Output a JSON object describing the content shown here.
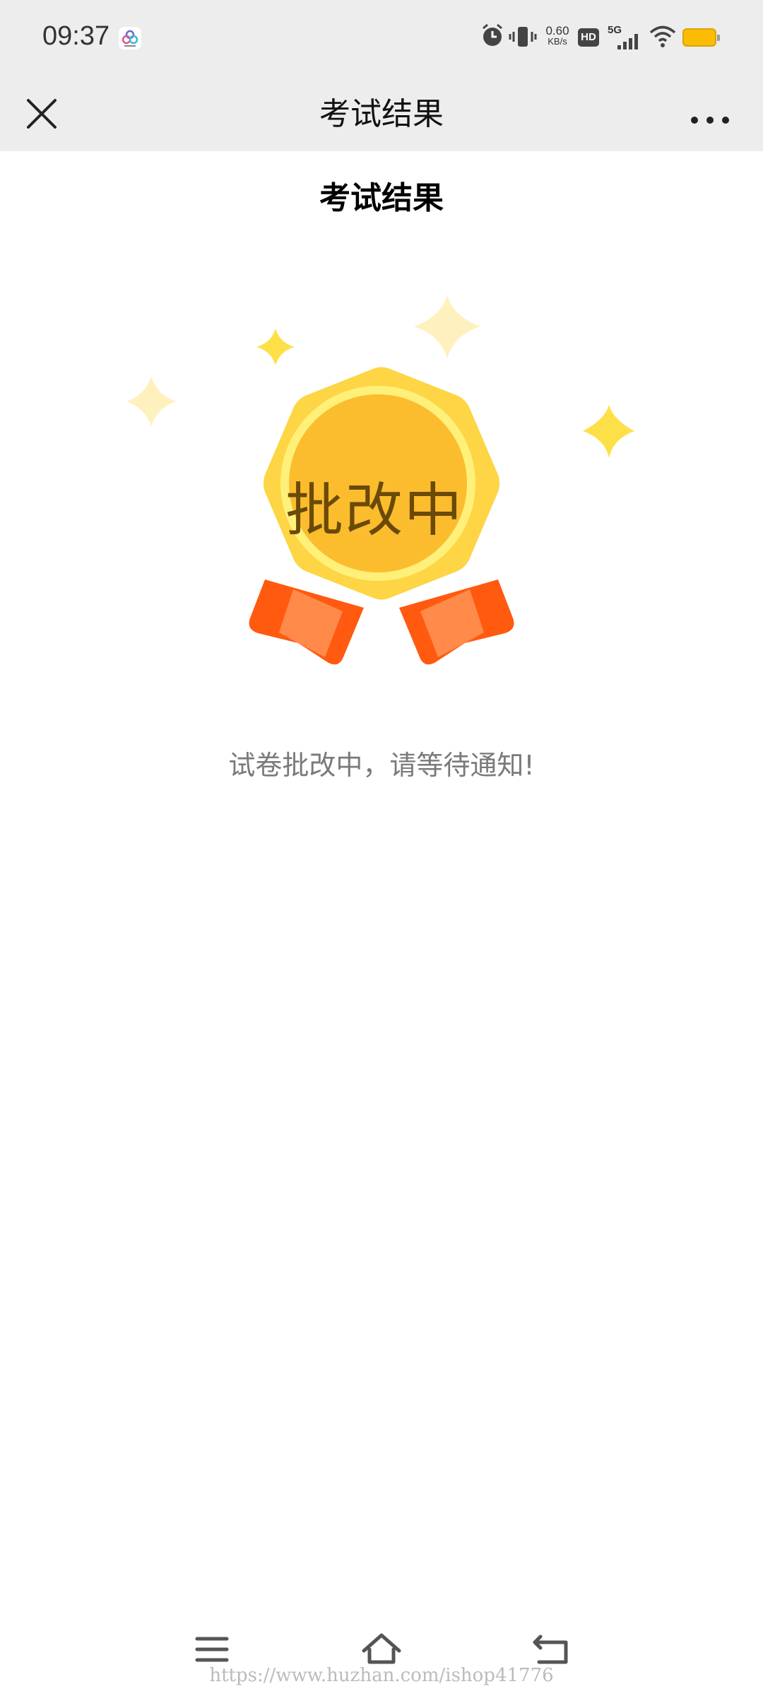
{
  "status_bar": {
    "time": "09:37",
    "net_speed_value": "0.60",
    "net_speed_unit": "KB/s",
    "hd_label": "HD",
    "network_label": "5G",
    "icons": [
      "app-notification-icon",
      "alarm-icon",
      "vibrate-icon",
      "hd-icon",
      "signal-icon",
      "wifi-icon",
      "battery-icon"
    ],
    "battery_color": "#fbbc05"
  },
  "nav_bar": {
    "title": "考试结果",
    "close_icon": "close-icon",
    "more_icon": "more-icon",
    "background": "#ededed"
  },
  "page": {
    "heading": "考试结果",
    "medal_label": "批改中",
    "message": "试卷批改中，请等待通知!",
    "medal_colors": {
      "outer": "#fdd545",
      "ring": "#fff07a",
      "inner": "#fbbd2e",
      "ribbon_dark": "#ff5a0f",
      "ribbon_light": "#ff8a4a",
      "sparkle": "#fde047"
    }
  },
  "system_nav": {
    "icons": [
      "menu-icon",
      "home-icon",
      "back-icon"
    ]
  },
  "watermark": "https://www.huzhan.com/ishop41776"
}
